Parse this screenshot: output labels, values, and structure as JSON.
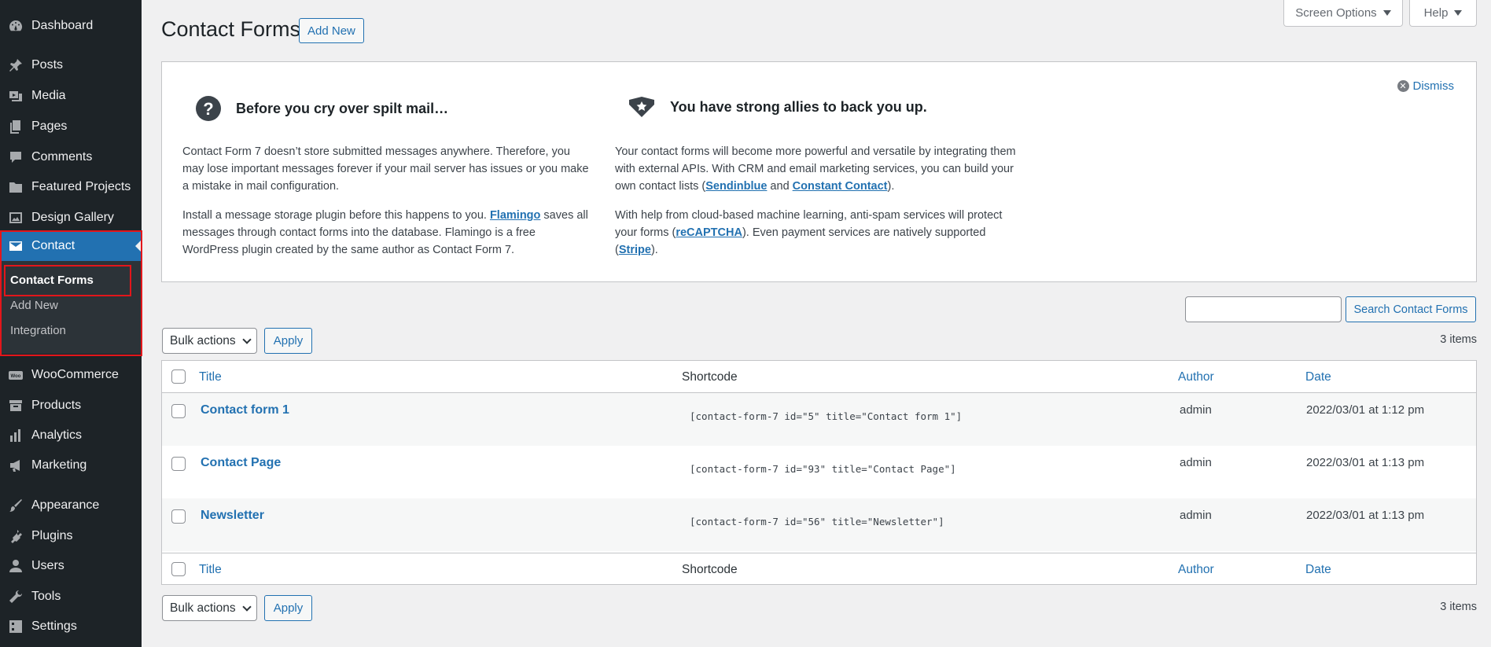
{
  "sidebar": {
    "items": [
      {
        "label": "Dashboard",
        "icon": "dashboard-icon"
      },
      {
        "label": "Posts",
        "icon": "pin-icon"
      },
      {
        "label": "Media",
        "icon": "media-icon"
      },
      {
        "label": "Pages",
        "icon": "pages-icon"
      },
      {
        "label": "Comments",
        "icon": "comment-icon"
      },
      {
        "label": "Featured Projects",
        "icon": "folder-icon"
      },
      {
        "label": "Design Gallery",
        "icon": "gallery-icon"
      },
      {
        "label": "Contact",
        "icon": "envelope-icon"
      },
      {
        "label": "WooCommerce",
        "icon": "woo-icon"
      },
      {
        "label": "Products",
        "icon": "archive-icon"
      },
      {
        "label": "Analytics",
        "icon": "bar-chart-icon"
      },
      {
        "label": "Marketing",
        "icon": "megaphone-icon"
      },
      {
        "label": "Appearance",
        "icon": "paintbrush-icon"
      },
      {
        "label": "Plugins",
        "icon": "plugin-icon"
      },
      {
        "label": "Users",
        "icon": "user-icon"
      },
      {
        "label": "Tools",
        "icon": "wrench-icon"
      },
      {
        "label": "Settings",
        "icon": "settings-icon"
      }
    ],
    "submenu": [
      {
        "label": "Contact Forms"
      },
      {
        "label": "Add New"
      },
      {
        "label": "Integration"
      }
    ]
  },
  "top_buttons": {
    "screen_options": "Screen Options",
    "help": "Help"
  },
  "header": {
    "title": "Contact Forms",
    "add_new": "Add New"
  },
  "welcome": {
    "dismiss": "Dismiss",
    "left": {
      "heading": "Before you cry over spilt mail…",
      "p1": "Contact Form 7 doesn’t store submitted messages anywhere. Therefore, you may lose important messages forever if your mail server has issues or you make a mistake in mail configuration.",
      "p2_a": "Install a message storage plugin before this happens to you. ",
      "p2_link": "Flamingo",
      "p2_b": " saves all messages through contact forms into the database. Flamingo is a free WordPress plugin created by the same author as Contact Form 7."
    },
    "right": {
      "heading": "You have strong allies to back you up.",
      "p1_a": "Your contact forms will become more powerful and versatile by integrating them with external APIs. With CRM and email marketing services, you can build your own contact lists (",
      "p1_link1": "Sendinblue",
      "p1_mid": " and ",
      "p1_link2": "Constant Contact",
      "p1_end": ").",
      "p2_a": "With help from cloud-based machine learning, anti-spam services will protect your forms (",
      "p2_link1": "reCAPTCHA",
      "p2_mid": "). Even payment services are natively supported (",
      "p2_link2": "Stripe",
      "p2_end": ")."
    }
  },
  "search": {
    "value": "",
    "button": "Search Contact Forms"
  },
  "bulk": {
    "label": "Bulk actions",
    "apply": "Apply",
    "count": "3 items"
  },
  "table": {
    "columns": {
      "title": "Title",
      "shortcode": "Shortcode",
      "author": "Author",
      "date": "Date"
    },
    "rows": [
      {
        "title": "Contact form 1",
        "shortcode": "[contact-form-7 id=\"5\" title=\"Contact form 1\"]",
        "author": "admin",
        "date": "2022/03/01 at 1:12 pm"
      },
      {
        "title": "Contact Page",
        "shortcode": "[contact-form-7 id=\"93\" title=\"Contact Page\"]",
        "author": "admin",
        "date": "2022/03/01 at 1:13 pm"
      },
      {
        "title": "Newsletter",
        "shortcode": "[contact-form-7 id=\"56\" title=\"Newsletter\"]",
        "author": "admin",
        "date": "2022/03/01 at 1:13 pm"
      }
    ]
  },
  "colors": {
    "accent": "#2271b1",
    "sidebar_bg": "#1d2327",
    "highlight_box": "#e3161b"
  }
}
